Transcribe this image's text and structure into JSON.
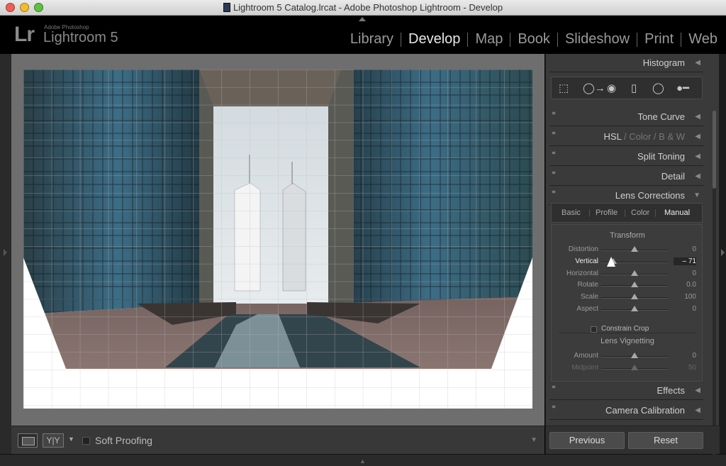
{
  "window": {
    "title": "Lightroom 5 Catalog.lrcat - Adobe Photoshop Lightroom - Develop"
  },
  "identity": {
    "logo": "Lr",
    "product_small": "Adobe Photoshop",
    "product_name": "Lightroom 5"
  },
  "modules": [
    "Library",
    "Develop",
    "Map",
    "Book",
    "Slideshow",
    "Print",
    "Web"
  ],
  "active_module": "Develop",
  "toolbar": {
    "soft_proofing": "Soft Proofing",
    "yy": "Y|Y"
  },
  "panels": {
    "histogram": "Histogram",
    "tone_curve": "Tone Curve",
    "hsl": {
      "a": "HSL",
      "b": "Color",
      "c": "B & W",
      "sep": "/"
    },
    "split_toning": "Split Toning",
    "detail": "Detail",
    "lens_corrections": "Lens Corrections",
    "effects": "Effects",
    "camera_calibration": "Camera Calibration"
  },
  "lens_tabs": {
    "basic": "Basic",
    "profile": "Profile",
    "color": "Color",
    "manual": "Manual",
    "sep": "|"
  },
  "transform": {
    "title": "Transform",
    "sliders": [
      {
        "label": "Distortion",
        "value": "0",
        "pos": 0.5
      },
      {
        "label": "Vertical",
        "value": "– 71",
        "pos": 0.18
      },
      {
        "label": "Horizontal",
        "value": "0",
        "pos": 0.5
      },
      {
        "label": "Rotate",
        "value": "0.0",
        "pos": 0.5
      },
      {
        "label": "Scale",
        "value": "100",
        "pos": 0.5
      },
      {
        "label": "Aspect",
        "value": "0",
        "pos": 0.5
      }
    ],
    "constrain_crop": "Constrain Crop"
  },
  "vignetting": {
    "title": "Lens Vignetting",
    "sliders": [
      {
        "label": "Amount",
        "value": "0",
        "pos": 0.5
      },
      {
        "label": "Midpoint",
        "value": "50",
        "pos": 0.5
      }
    ]
  },
  "buttons": {
    "previous": "Previous",
    "reset": "Reset"
  }
}
